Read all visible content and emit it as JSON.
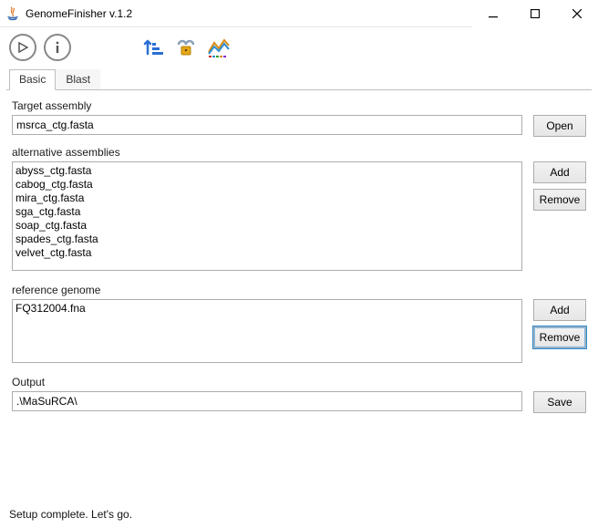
{
  "window": {
    "title": "GenomeFinisher v.1.2"
  },
  "tabs": [
    {
      "label": "Basic",
      "active": true
    },
    {
      "label": "Blast",
      "active": false
    }
  ],
  "sections": {
    "target": {
      "label": "Target assembly",
      "value": "msrca_ctg.fasta",
      "open_label": "Open"
    },
    "alt": {
      "label": "alternative assemblies",
      "items": [
        "abyss_ctg.fasta",
        "cabog_ctg.fasta",
        "mira_ctg.fasta",
        "sga_ctg.fasta",
        "soap_ctg.fasta",
        "spades_ctg.fasta",
        "velvet_ctg.fasta"
      ],
      "add_label": "Add",
      "remove_label": "Remove"
    },
    "ref": {
      "label": "reference genome",
      "items": [
        "FQ312004.fna"
      ],
      "add_label": "Add",
      "remove_label": "Remove"
    },
    "output": {
      "label": "Output",
      "value": ".\\MaSuRCA\\",
      "save_label": "Save"
    }
  },
  "status": "Setup complete. Let's go."
}
